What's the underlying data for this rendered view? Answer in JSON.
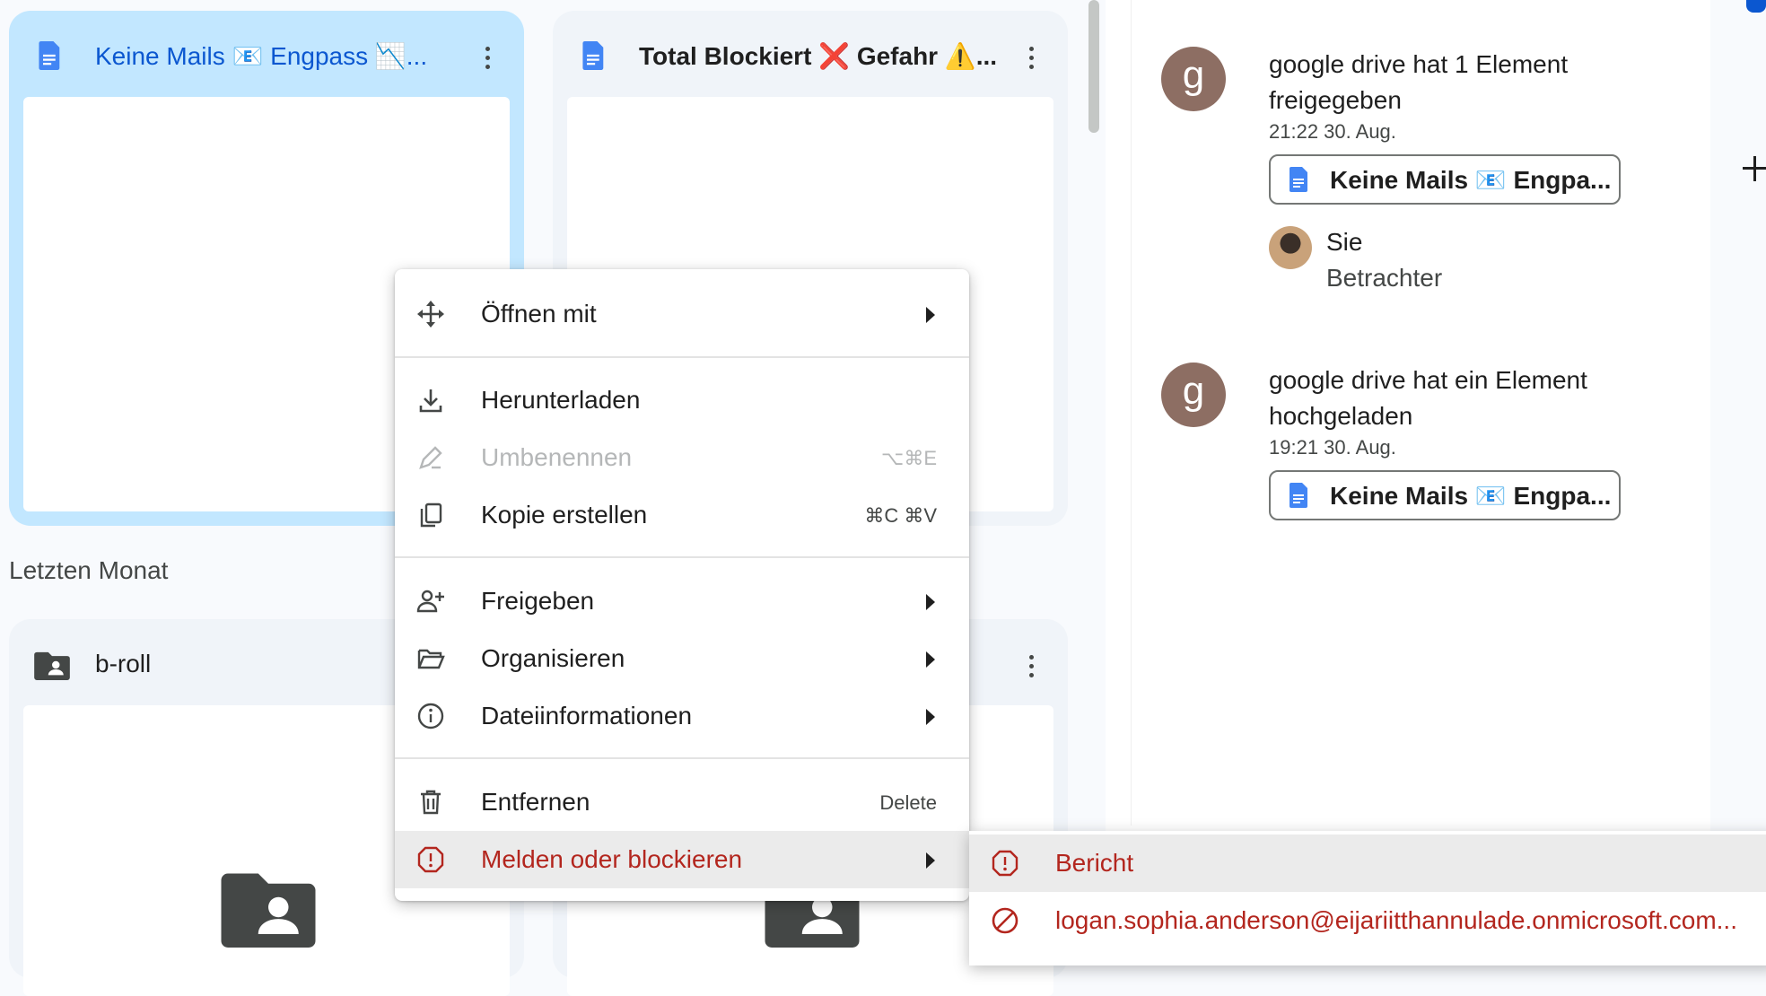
{
  "files": {
    "card1": {
      "title": "Keine Mails 📧 Engpass 📉...",
      "selected": true
    },
    "card2": {
      "title": "Total Blockiert ❌ Gefahr ⚠️..."
    },
    "section_label": "Letzten Monat",
    "folder1": {
      "title": "b-roll"
    }
  },
  "context_menu": {
    "items": [
      {
        "label": "Öffnen mit",
        "icon": "move-arrows-icon",
        "submenu": true
      },
      {
        "label": "Herunterladen",
        "icon": "download-icon"
      },
      {
        "label": "Umbenennen",
        "icon": "pencil-icon",
        "shortcut": "⌥⌘E",
        "disabled": true
      },
      {
        "label": "Kopie erstellen",
        "icon": "copy-icon",
        "shortcut": "⌘C ⌘V"
      },
      {
        "label": "Freigeben",
        "icon": "person-add-icon",
        "submenu": true
      },
      {
        "label": "Organisieren",
        "icon": "folder-open-icon",
        "submenu": true
      },
      {
        "label": "Dateiinformationen",
        "icon": "info-icon",
        "submenu": true
      },
      {
        "label": "Entfernen",
        "icon": "trash-icon",
        "shortcut": "Delete"
      },
      {
        "label": "Melden oder blockieren",
        "icon": "alert-icon",
        "submenu": true,
        "highlighted": true
      }
    ]
  },
  "submenu": {
    "items": [
      {
        "label": "Bericht",
        "icon": "alert-icon"
      },
      {
        "label": "logan.sophia.anderson@eijariitthannulade.onmicrosoft.com...",
        "icon": "block-icon"
      }
    ]
  },
  "activity": {
    "entries": [
      {
        "avatar": "g",
        "text": "google drive hat 1 Element freigegeben",
        "time": "21:22 30. Aug.",
        "file_chip": "Keine Mails 📧 Engpa...",
        "user_name": "Sie",
        "user_role": "Betrachter"
      },
      {
        "avatar": "g",
        "text": "google drive hat ein Element hochgeladen",
        "time": "19:21 30. Aug.",
        "file_chip": "Keine Mails 📧 Engpa..."
      }
    ]
  },
  "colors": {
    "selected_card": "#c2e7ff",
    "accent_blue": "#0b57d0",
    "danger_red": "#b3261e",
    "doc_icon_blue": "#4285f4"
  }
}
